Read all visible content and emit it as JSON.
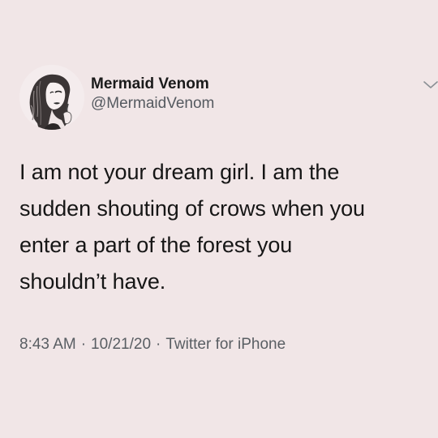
{
  "tweet": {
    "author": {
      "display_name": "Mermaid Venom",
      "handle": "@MermaidVenom",
      "avatar_icon": "illustrated-woman-portrait-avatar"
    },
    "menu_icon": "chevron-down-icon",
    "text_lines": [
      "I am not your dream girl. I am the",
      "sudden shouting of crows when you",
      "enter a part of the forest you",
      "shouldn’t have."
    ],
    "meta": {
      "time": "8:43 AM",
      "separator": "·",
      "date": "10/21/20",
      "source": "Twitter for iPhone"
    },
    "colors": {
      "background": "#f1e6e7",
      "text": "#161616",
      "secondary_text": "#595e63"
    }
  }
}
